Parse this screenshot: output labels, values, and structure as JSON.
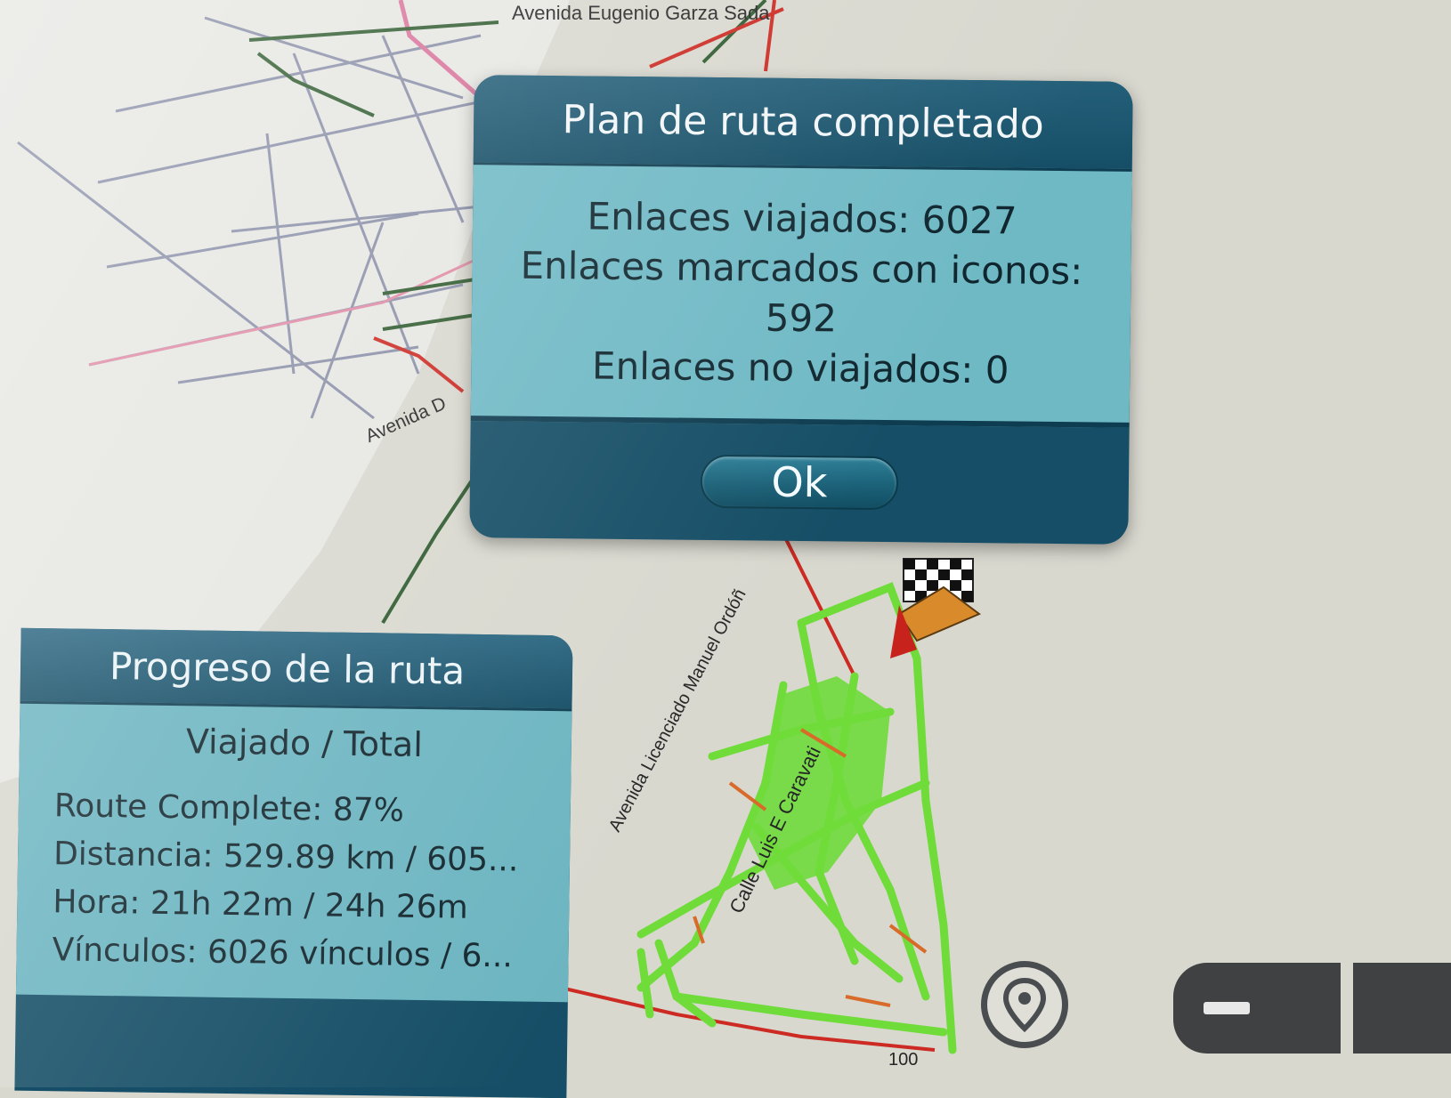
{
  "map": {
    "street_labels": [
      "Avenida Eugenio Garza Sada",
      "Avenida D",
      "Avenida Licenciado Manuel Ordóñ",
      "Calle Luis E Caravati",
      "100"
    ],
    "colors": {
      "background": "#d8d8cf",
      "traveled_route": "#6fdc3a",
      "main_road": "#cc2a22",
      "secondary_road": "#2f5b2f",
      "minor_road": "#8a8fa8"
    },
    "destination_flag_icon": "checkered-flag-icon",
    "vehicle_icon": "navigation-arrow-icon"
  },
  "dialog": {
    "title": "Plan de ruta completado",
    "lines": [
      "Enlaces viajados: 6027",
      "Enlaces marcados con iconos:",
      "592",
      "Enlaces no viajados: 0"
    ],
    "ok_label": "Ok"
  },
  "progress_panel": {
    "title": "Progreso de la ruta",
    "subheader": "Viajado / Total",
    "rows": [
      "Route Complete: 87%",
      "Distancia: 529.89 km / 605...",
      "Hora: 21h 22m / 24h 26m",
      "Vínculos: 6026 vínculos / 6..."
    ]
  },
  "controls": {
    "locate_icon": "location-pin-icon",
    "zoom_out_icon": "minus-icon"
  }
}
